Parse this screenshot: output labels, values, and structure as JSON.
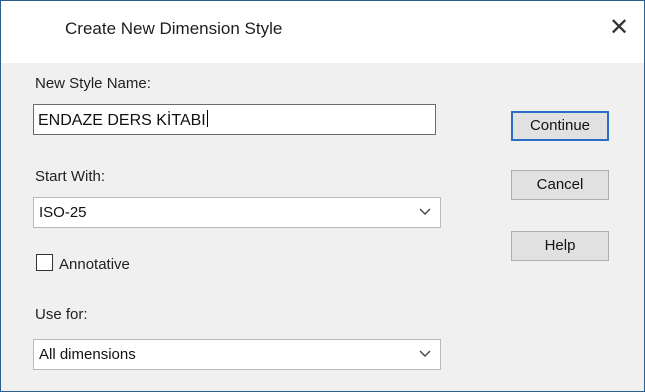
{
  "window": {
    "title": "Create New Dimension Style",
    "close_glyph": "✕"
  },
  "form": {
    "new_style_name_label": "New Style Name:",
    "new_style_name_value": "ENDAZE DERS KİTABI",
    "start_with_label": "Start With:",
    "start_with_value": "ISO-25",
    "annotative_label": "Annotative",
    "annotative_checked": false,
    "use_for_label": "Use for:",
    "use_for_value": "All dimensions"
  },
  "buttons": {
    "continue": "Continue",
    "cancel": "Cancel",
    "help": "Help"
  },
  "icons": {
    "close": "close-icon",
    "dropdown": "chevron-down-icon"
  },
  "colors": {
    "window_border": "#2c5d8f",
    "default_button_border": "#2b6cc4",
    "background": "#f0f0f0"
  }
}
